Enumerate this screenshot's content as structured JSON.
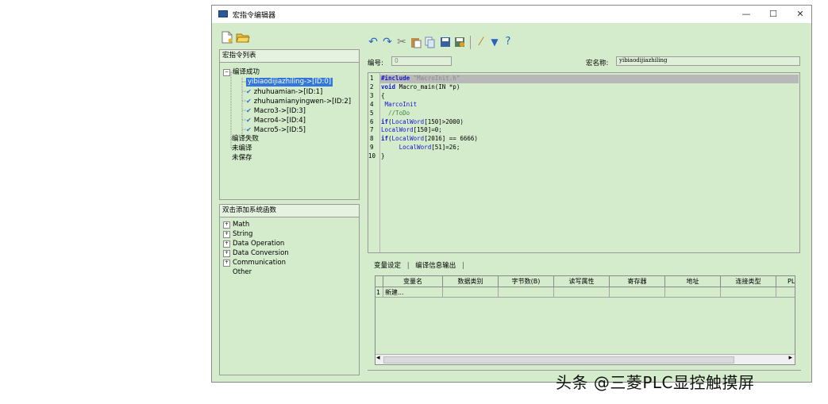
{
  "window": {
    "title": "宏指令编辑器",
    "minimize": "—",
    "maximize": "☐",
    "close": "✕"
  },
  "left_toolbar": {
    "new_icon": "new-file-icon",
    "open_icon": "open-folder-icon"
  },
  "macro_list": {
    "header": "宏指令列表",
    "groups": [
      {
        "label": "编译成功",
        "items": [
          "yibiaodijiazhiling->[ID:0]",
          "zhuhuamian->[ID:1]",
          "zhuhuamianyingwen->[ID:2]",
          "Macro3->[ID:3]",
          "Macro4->[ID:4]",
          "Macro5->[ID:5]"
        ]
      },
      {
        "label": "编译失败"
      },
      {
        "label": "未编译"
      },
      {
        "label": "未保存"
      }
    ]
  },
  "system_functions": {
    "header": "双击添加系统函数",
    "items": [
      "Math",
      "String",
      "Data Operation",
      "Data Conversion",
      "Communication",
      "Other"
    ]
  },
  "fields": {
    "number_label": "编号:",
    "number_value": "0",
    "name_label": "宏名称:",
    "name_value": "yibiaodijiazhiling"
  },
  "editor": {
    "line_numbers": [
      "1",
      "2",
      "3",
      "4",
      "5",
      "6",
      "7",
      "8",
      "9",
      "10"
    ]
  },
  "bottom_tabs": {
    "tab1": "变量设定",
    "tab2": "编译信息输出"
  },
  "variable_table": {
    "columns": [
      "变量名",
      "数据类别",
      "字节数(B)",
      "读写属性",
      "寄存器",
      "地址",
      "连接类型",
      "PL"
    ],
    "row_number": "1",
    "row_value": "新建..."
  },
  "scroll": {
    "left_arrow": "◂",
    "right_arrow": "▸"
  },
  "watermark": "头条 @三菱PLC显控触摸屏",
  "colors": {
    "panel_bg": "#d4ebcc",
    "selection": "#3377dd",
    "keyword": "#1515cc"
  }
}
